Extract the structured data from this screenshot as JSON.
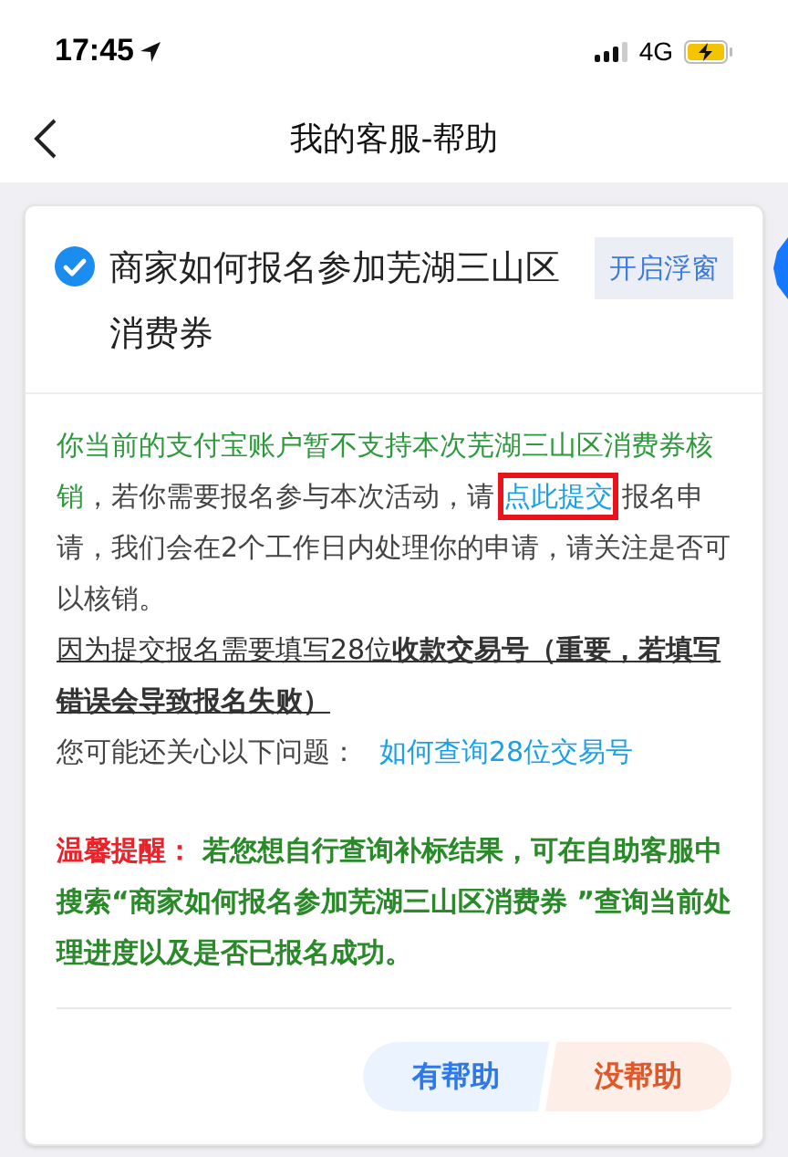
{
  "status_bar": {
    "time": "17:45",
    "network": "4G",
    "charging": true
  },
  "nav": {
    "title": "我的客服-帮助"
  },
  "card": {
    "question": {
      "checked": true,
      "title": "商家如何报名参加芜湖三山区消费券",
      "float_button": "开启浮窗"
    },
    "notice": {
      "highlight": "你当前的支付宝账户暂不支持本次芜湖三山区消费券核销",
      "before_link": "，若你需要报名参与本次活动，请",
      "link": "点此提交",
      "after_link": "报名申请，我们会在2个工作日内处理你的申请，请关注是否可以核销。",
      "link_boxed": true
    },
    "warning": "因为提交报名需要填写28位**收款交易号（重要，若填写错误会导致报名失败）**",
    "related": {
      "label": "您可能还关心以下问题：",
      "link": "如何查询28位交易号"
    },
    "tip": {
      "label": "温馨提醒：",
      "text": "若您想自行查询补标结果，可在自助客服中搜索“商家如何报名参加芜湖三山区消费券 ”查询当前处理进度以及是否已报名成功。"
    },
    "feedback": [
      {
        "kind": "helpful",
        "label": "有帮助"
      },
      {
        "kind": "not_helpful",
        "label": "没帮助"
      }
    ]
  }
}
